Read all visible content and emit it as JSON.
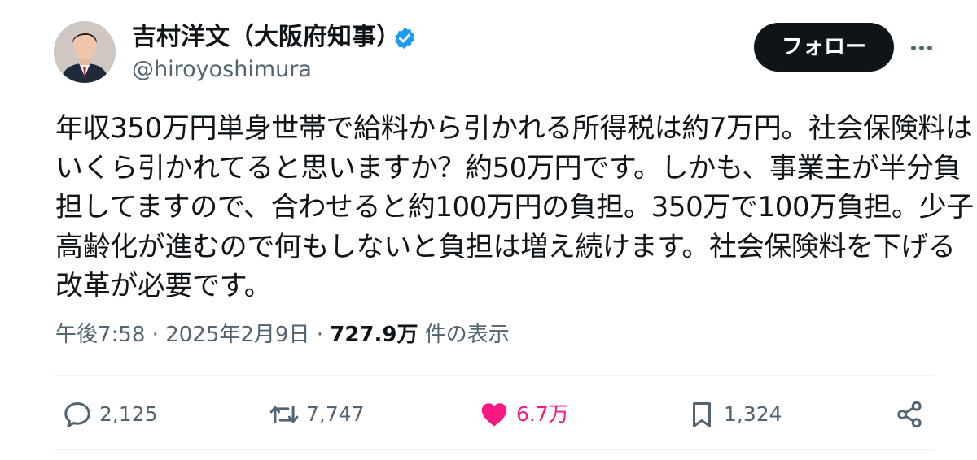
{
  "author": {
    "display_name": "吉村洋文（大阪府知事）",
    "handle": "@hiroyoshimura",
    "verified_icon": "verified-badge-icon",
    "avatar": "profile-photo"
  },
  "header": {
    "follow_label": "フォロー",
    "more_icon": "more-options-icon"
  },
  "tweet": {
    "lines": [
      "年収350万円単身世帯で給料から引かれる所得税は約7万円。社会保険料は",
      "いくら引かれてると思いますか？約50万円です。しかも、事業主が半分負",
      "担してますので、合わせると約100万円の負担。350万で100万負担。少子",
      "高齢化が進むので何もしないと負担は増え続けます。社会保険料を下げる",
      "改革が必要です。"
    ]
  },
  "meta": {
    "time": "午後7:58",
    "separator1": " · ",
    "date": "2025年2月9日",
    "separator2": " · ",
    "views_count": "727.9万",
    "views_label": " 件の表示"
  },
  "actions": {
    "reply": {
      "icon": "reply-icon",
      "count": "2,125"
    },
    "retweet": {
      "icon": "retweet-icon",
      "count": "7,747"
    },
    "like": {
      "icon": "heart-icon",
      "count": "6.7万",
      "active": true
    },
    "bookmark": {
      "icon": "bookmark-icon",
      "count": "1,324"
    },
    "share": {
      "icon": "share-icon"
    }
  },
  "colors": {
    "text_primary": "#0f1419",
    "text_secondary": "#536471",
    "verified_blue": "#1d9bf0",
    "like_pink": "#f91880",
    "follow_button_bg": "#0f1419",
    "divider": "#eff3f4"
  }
}
